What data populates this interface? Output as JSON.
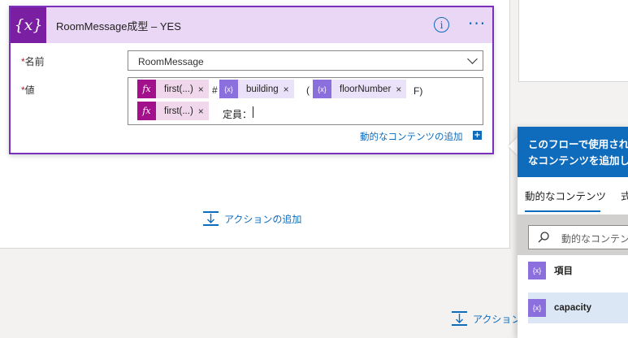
{
  "card": {
    "icon_text": "{x}",
    "title": "RoomMessage成型 – YES",
    "info_symbol": "i",
    "more_symbol": "···"
  },
  "fields": {
    "required_mark": "*",
    "name_label": "名前",
    "value_label": "値",
    "name_value": "RoomMessage"
  },
  "value_tokens": {
    "fx_icon_text": "fx",
    "dyn_icon_text": "{x}",
    "remove_symbol": "×",
    "first_1": "first(...)",
    "first_2": "first(...)",
    "building": "building",
    "floor_number": "floorNumber",
    "text_hash": "#",
    "text_open_paren": "(",
    "text_close": "F)",
    "text_capacity_label": "定員："
  },
  "add_dynamic_content_link": "動的なコンテンツの追加",
  "add_dynamic_plus": "+",
  "add_action_main": "アクションの追加",
  "add_action_bottom": "アクション",
  "flyout": {
    "header_line1": "このフローで使用され",
    "header_line2": "なコンテンツを追加し",
    "tab_dynamic": "動的なコンテンツ",
    "tab_expression": "式",
    "search_placeholder": "動的なコンテンツ",
    "items": [
      {
        "label": "項目",
        "icon": "{x}"
      },
      {
        "label": "capacity",
        "icon": "{x}"
      }
    ]
  },
  "colors": {
    "accent_purple": "#7b2fbf",
    "header_purple": "#ead7f6",
    "link_blue": "#0f6cbd",
    "fx_magenta": "#a3108c",
    "dyn_violet": "#8b6fdc"
  }
}
